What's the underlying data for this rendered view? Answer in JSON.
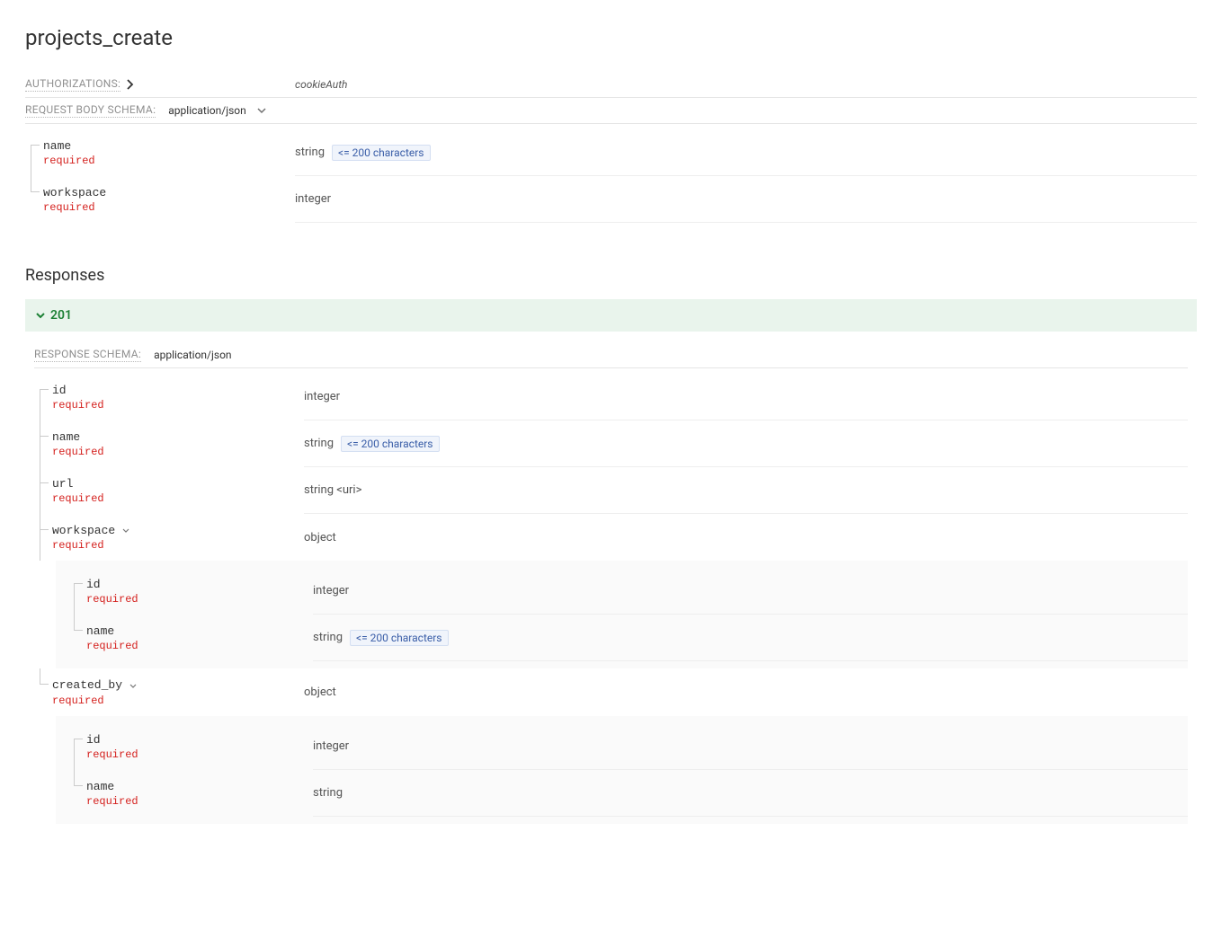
{
  "title": "projects_create",
  "auth": {
    "label": "AUTHORIZATIONS:",
    "value": "cookieAuth"
  },
  "requestBody": {
    "label": "REQUEST BODY SCHEMA:",
    "contentType": "application/json",
    "params": [
      {
        "name": "name",
        "req": "required",
        "type": "string",
        "constraint": "<= 200 characters"
      },
      {
        "name": "workspace",
        "req": "required",
        "type": "integer",
        "constraint": null
      }
    ]
  },
  "responses": {
    "heading": "Responses",
    "items": [
      {
        "code": "201",
        "schemaLabel": "RESPONSE SCHEMA:",
        "contentType": "application/json",
        "params": [
          {
            "name": "id",
            "req": "required",
            "type": "integer",
            "constraint": null,
            "expandable": false
          },
          {
            "name": "name",
            "req": "required",
            "type": "string",
            "constraint": "<= 200 characters",
            "expandable": false
          },
          {
            "name": "url",
            "req": "required",
            "type": "string <uri>",
            "constraint": null,
            "expandable": false
          },
          {
            "name": "workspace",
            "req": "required",
            "type": "object",
            "constraint": null,
            "expandable": true,
            "children": [
              {
                "name": "id",
                "req": "required",
                "type": "integer",
                "constraint": null
              },
              {
                "name": "name",
                "req": "required",
                "type": "string",
                "constraint": "<= 200 characters"
              }
            ]
          },
          {
            "name": "created_by",
            "req": "required",
            "type": "object",
            "constraint": null,
            "expandable": true,
            "children": [
              {
                "name": "id",
                "req": "required",
                "type": "integer",
                "constraint": null
              },
              {
                "name": "name",
                "req": "required",
                "type": "string",
                "constraint": null
              }
            ]
          }
        ]
      }
    ]
  }
}
